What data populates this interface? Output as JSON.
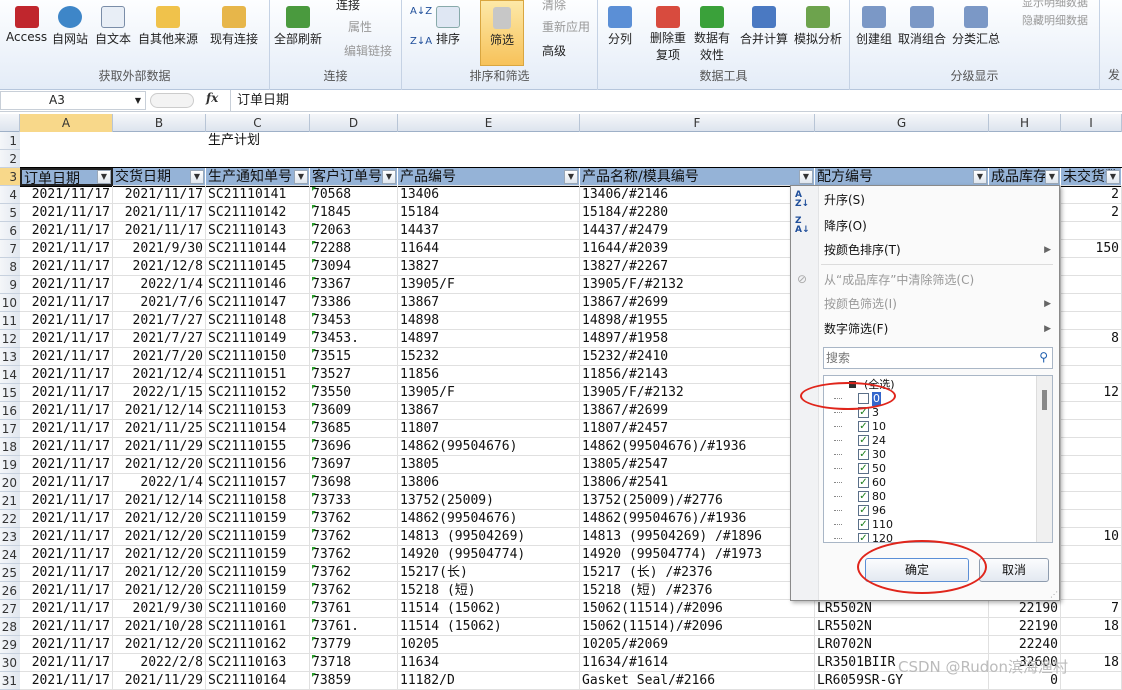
{
  "ribbon": {
    "groups": [
      {
        "label": "获取外部数据",
        "buttons": [
          "Access",
          "自网站",
          "自文本",
          "自其他来源",
          "现有连接"
        ]
      },
      {
        "label": "连接",
        "buttons": [
          "全部刷新"
        ],
        "small": [
          "连接",
          "属性",
          "编辑链接"
        ]
      },
      {
        "label": "排序和筛选",
        "buttons": [
          "排序",
          "筛选"
        ],
        "small": [
          "清除",
          "重新应用",
          "高级"
        ]
      },
      {
        "label": "数据工具",
        "buttons": [
          "分列",
          "删除重复项",
          "数据有效性",
          "合并计算",
          "模拟分析"
        ]
      },
      {
        "label": "分级显示",
        "buttons": [
          "创建组",
          "取消组合",
          "分类汇总"
        ],
        "small": [
          "显示明细数据",
          "隐藏明细数据"
        ]
      }
    ],
    "sort_az": "A↓Z",
    "sort_za": "Z↓A",
    "last_group_partial": "发"
  },
  "formula_bar": {
    "name_box": "A3",
    "fx": "fx",
    "content": "订单日期"
  },
  "columns": [
    "A",
    "B",
    "C",
    "D",
    "E",
    "F",
    "G",
    "H",
    "I"
  ],
  "selected_column": "A",
  "title_row": {
    "row": "1",
    "text": "生产计划"
  },
  "row2": "2",
  "header_row": {
    "row": "3",
    "cells": [
      "订单日期",
      "交货日期",
      "生产通知单号",
      "客户订单号",
      "产品编号",
      "产品名称/模具编号",
      "配方编号",
      "成品库存",
      "未交货数"
    ]
  },
  "rows": [
    {
      "n": "4",
      "a": "2021/11/17",
      "b": "2021/11/17",
      "c": "SC21110141",
      "d": "70568",
      "e": "13406",
      "f": "13406/#2146",
      "g": "",
      "h": "",
      "i": "2"
    },
    {
      "n": "5",
      "a": "2021/11/17",
      "b": "2021/11/17",
      "c": "SC21110142",
      "d": "71845",
      "e": "15184",
      "f": "15184/#2280",
      "g": "",
      "h": "",
      "i": "2"
    },
    {
      "n": "6",
      "a": "2021/11/17",
      "b": "2021/11/17",
      "c": "SC21110143",
      "d": "72063",
      "e": "14437",
      "f": "14437/#2479",
      "g": "",
      "h": "",
      "i": ""
    },
    {
      "n": "7",
      "a": "2021/11/17",
      "b": "2021/9/30",
      "c": "SC21110144",
      "d": "72288",
      "e": "11644",
      "f": "11644/#2039",
      "g": "",
      "h": "",
      "i": "150"
    },
    {
      "n": "8",
      "a": "2021/11/17",
      "b": "2021/12/8",
      "c": "SC21110145",
      "d": "73094",
      "e": "13827",
      "f": "13827/#2267",
      "g": "",
      "h": "",
      "i": ""
    },
    {
      "n": "9",
      "a": "2021/11/17",
      "b": "2022/1/4",
      "c": "SC21110146",
      "d": "73367",
      "e": "13905/F",
      "f": "13905/F/#2132",
      "g": "",
      "h": "",
      "i": ""
    },
    {
      "n": "10",
      "a": "2021/11/17",
      "b": "2021/7/6",
      "c": "SC21110147",
      "d": "73386",
      "e": "13867",
      "f": "13867/#2699",
      "g": "",
      "h": "",
      "i": ""
    },
    {
      "n": "11",
      "a": "2021/11/17",
      "b": "2021/7/27",
      "c": "SC21110148",
      "d": "73453",
      "e": "14898",
      "f": "14898/#1955",
      "g": "",
      "h": "",
      "i": ""
    },
    {
      "n": "12",
      "a": "2021/11/17",
      "b": "2021/7/27",
      "c": "SC21110149",
      "d": "73453.",
      "e": "14897",
      "f": "14897/#1958",
      "g": "",
      "h": "",
      "i": "8"
    },
    {
      "n": "13",
      "a": "2021/11/17",
      "b": "2021/7/20",
      "c": "SC21110150",
      "d": "73515",
      "e": "15232",
      "f": "15232/#2410",
      "g": "",
      "h": "",
      "i": ""
    },
    {
      "n": "14",
      "a": "2021/11/17",
      "b": "2021/12/4",
      "c": "SC21110151",
      "d": "73527",
      "e": "11856",
      "f": "11856/#2143",
      "g": "",
      "h": "",
      "i": ""
    },
    {
      "n": "15",
      "a": "2021/11/17",
      "b": "2022/1/15",
      "c": "SC21110152",
      "d": "73550",
      "e": "13905/F",
      "f": "13905/F/#2132",
      "g": "",
      "h": "",
      "i": "12"
    },
    {
      "n": "16",
      "a": "2021/11/17",
      "b": "2021/12/14",
      "c": "SC21110153",
      "d": "73609",
      "e": "13867",
      "f": "13867/#2699",
      "g": "",
      "h": "",
      "i": ""
    },
    {
      "n": "17",
      "a": "2021/11/17",
      "b": "2021/11/25",
      "c": "SC21110154",
      "d": "73685",
      "e": "11807",
      "f": "11807/#2457",
      "g": "",
      "h": "",
      "i": ""
    },
    {
      "n": "18",
      "a": "2021/11/17",
      "b": "2021/11/29",
      "c": "SC21110155",
      "d": "73696",
      "e": "14862(99504676)",
      "f": "14862(99504676)/#1936",
      "g": "",
      "h": "",
      "i": ""
    },
    {
      "n": "19",
      "a": "2021/11/17",
      "b": "2021/12/20",
      "c": "SC21110156",
      "d": "73697",
      "e": "13805",
      "f": "13805/#2547",
      "g": "",
      "h": "",
      "i": ""
    },
    {
      "n": "20",
      "a": "2021/11/17",
      "b": "2022/1/4",
      "c": "SC21110157",
      "d": "73698",
      "e": "13806",
      "f": "13806/#2541",
      "g": "",
      "h": "",
      "i": ""
    },
    {
      "n": "21",
      "a": "2021/11/17",
      "b": "2021/12/14",
      "c": "SC21110158",
      "d": "73733",
      "e": "13752(25009)",
      "f": "13752(25009)/#2776",
      "g": "",
      "h": "",
      "i": ""
    },
    {
      "n": "22",
      "a": "2021/11/17",
      "b": "2021/12/20",
      "c": "SC21110159",
      "d": "73762",
      "e": "14862(99504676)",
      "f": "14862(99504676)/#1936",
      "g": "",
      "h": "",
      "i": ""
    },
    {
      "n": "23",
      "a": "2021/11/17",
      "b": "2021/12/20",
      "c": "SC21110159",
      "d": "73762",
      "e": "14813 (99504269)",
      "f": "14813 (99504269) /#1896",
      "g": "",
      "h": "",
      "i": "10"
    },
    {
      "n": "24",
      "a": "2021/11/17",
      "b": "2021/12/20",
      "c": "SC21110159",
      "d": "73762",
      "e": "14920 (99504774)",
      "f": "14920 (99504774) /#1973",
      "g": "",
      "h": "",
      "i": ""
    },
    {
      "n": "25",
      "a": "2021/11/17",
      "b": "2021/12/20",
      "c": "SC21110159",
      "d": "73762",
      "e": "15217(长)",
      "f": "15217 (长) /#2376",
      "g": "",
      "h": "",
      "i": ""
    },
    {
      "n": "26",
      "a": "2021/11/17",
      "b": "2021/12/20",
      "c": "SC21110159",
      "d": "73762",
      "e": "15218 (短)",
      "f": "15218 (短) /#2376",
      "g": "",
      "h": "",
      "i": ""
    },
    {
      "n": "27",
      "a": "2021/11/17",
      "b": "2021/9/30",
      "c": "SC21110160",
      "d": "73761",
      "e": "11514 (15062)",
      "f": "15062(11514)/#2096",
      "g": "LR5502N",
      "h": "22190",
      "i": "7"
    },
    {
      "n": "28",
      "a": "2021/11/17",
      "b": "2021/10/28",
      "c": "SC21110161",
      "d": "73761.",
      "e": "11514 (15062)",
      "f": "15062(11514)/#2096",
      "g": "LR5502N",
      "h": "22190",
      "i": "18"
    },
    {
      "n": "29",
      "a": "2021/11/17",
      "b": "2021/12/20",
      "c": "SC21110162",
      "d": "73779",
      "e": "10205",
      "f": "10205/#2069",
      "g": "LR0702N",
      "h": "22240",
      "i": ""
    },
    {
      "n": "30",
      "a": "2021/11/17",
      "b": "2022/2/8",
      "c": "SC21110163",
      "d": "73718",
      "e": "11634",
      "f": "11634/#1614",
      "g": "LR3501BIIR",
      "h": "32600",
      "i": "18"
    },
    {
      "n": "31",
      "a": "2021/11/17",
      "b": "2021/11/29",
      "c": "SC21110164",
      "d": "73859",
      "e": "11182/D",
      "f": "Gasket Seal/#2166",
      "g": "LR6059SR-GY",
      "h": "0",
      "i": ""
    }
  ],
  "filter_menu": {
    "sort_asc": "升序(S)",
    "sort_desc": "降序(O)",
    "sort_color": "按颜色排序(T)",
    "clear_filter": "从“成品库存”中清除筛选(C)",
    "color_filter": "按颜色筛选(I)",
    "number_filter": "数字筛选(F)",
    "search_placeholder": "搜索",
    "select_all": "(全选)",
    "values": [
      {
        "v": "0",
        "checked": false
      },
      {
        "v": "3",
        "checked": true
      },
      {
        "v": "10",
        "checked": true
      },
      {
        "v": "24",
        "checked": true
      },
      {
        "v": "30",
        "checked": true
      },
      {
        "v": "50",
        "checked": true
      },
      {
        "v": "60",
        "checked": true
      },
      {
        "v": "80",
        "checked": true
      },
      {
        "v": "96",
        "checked": true
      },
      {
        "v": "110",
        "checked": true
      },
      {
        "v": "120",
        "checked": true
      }
    ],
    "ok": "确定",
    "cancel": "取消"
  },
  "watermark": "CSDN @Rudon滨海渔村"
}
